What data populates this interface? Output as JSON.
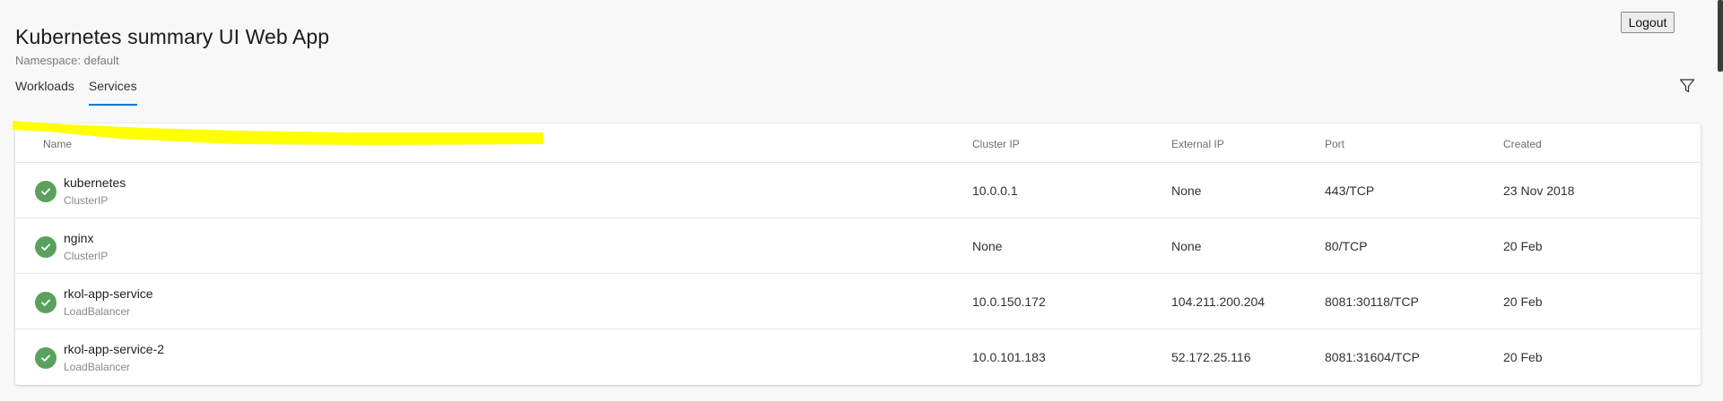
{
  "header": {
    "title": "Kubernetes summary UI Web App",
    "namespace": "Namespace: default",
    "logout_label": "Logout"
  },
  "tabs": [
    {
      "label": "Workloads",
      "active": false
    },
    {
      "label": "Services",
      "active": true
    }
  ],
  "colors": {
    "accent": "#0078d4",
    "status_ok": "#5aa15e",
    "highlight": "#ffff00"
  },
  "table": {
    "columns": [
      "Name",
      "Cluster IP",
      "External IP",
      "Port",
      "Created"
    ],
    "rows": [
      {
        "name": "kubernetes",
        "type": "ClusterIP",
        "cluster_ip": "10.0.0.1",
        "external_ip": "None",
        "port": "443/TCP",
        "created": "23 Nov 2018",
        "status": "check-icon"
      },
      {
        "name": "nginx",
        "type": "ClusterIP",
        "cluster_ip": "None",
        "external_ip": "None",
        "port": "80/TCP",
        "created": "20 Feb",
        "status": "check-icon"
      },
      {
        "name": "rkol-app-service",
        "type": "LoadBalancer",
        "cluster_ip": "10.0.150.172",
        "external_ip": "104.211.200.204",
        "port": "8081:30118/TCP",
        "created": "20 Feb",
        "status": "check-icon"
      },
      {
        "name": "rkol-app-service-2",
        "type": "LoadBalancer",
        "cluster_ip": "10.0.101.183",
        "external_ip": "52.172.25.116",
        "port": "8081:31604/TCP",
        "created": "20 Feb",
        "status": "check-icon"
      }
    ]
  }
}
